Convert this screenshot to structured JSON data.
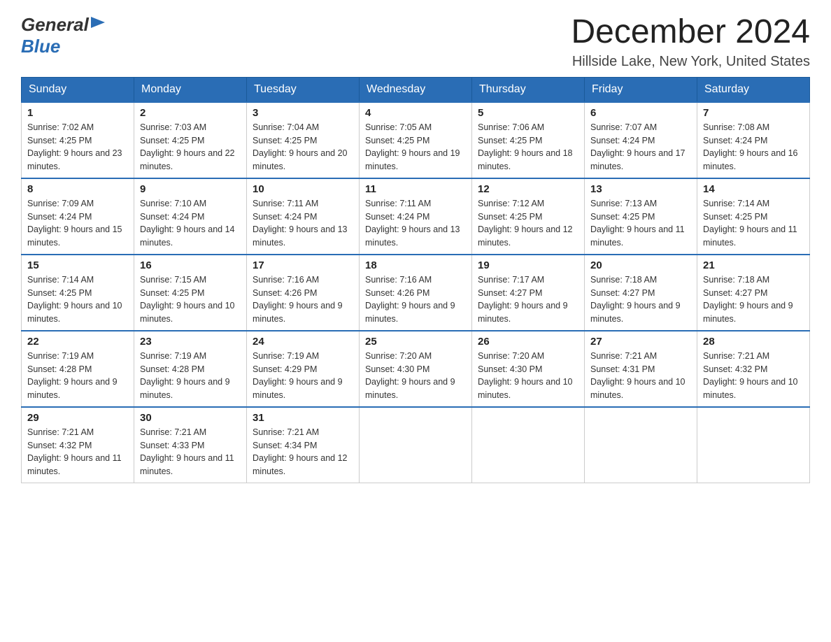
{
  "header": {
    "month_year": "December 2024",
    "location": "Hillside Lake, New York, United States"
  },
  "days_of_week": [
    "Sunday",
    "Monday",
    "Tuesday",
    "Wednesday",
    "Thursday",
    "Friday",
    "Saturday"
  ],
  "weeks": [
    [
      {
        "day": "1",
        "sunrise": "7:02 AM",
        "sunset": "4:25 PM",
        "daylight": "9 hours and 23 minutes."
      },
      {
        "day": "2",
        "sunrise": "7:03 AM",
        "sunset": "4:25 PM",
        "daylight": "9 hours and 22 minutes."
      },
      {
        "day": "3",
        "sunrise": "7:04 AM",
        "sunset": "4:25 PM",
        "daylight": "9 hours and 20 minutes."
      },
      {
        "day": "4",
        "sunrise": "7:05 AM",
        "sunset": "4:25 PM",
        "daylight": "9 hours and 19 minutes."
      },
      {
        "day": "5",
        "sunrise": "7:06 AM",
        "sunset": "4:25 PM",
        "daylight": "9 hours and 18 minutes."
      },
      {
        "day": "6",
        "sunrise": "7:07 AM",
        "sunset": "4:24 PM",
        "daylight": "9 hours and 17 minutes."
      },
      {
        "day": "7",
        "sunrise": "7:08 AM",
        "sunset": "4:24 PM",
        "daylight": "9 hours and 16 minutes."
      }
    ],
    [
      {
        "day": "8",
        "sunrise": "7:09 AM",
        "sunset": "4:24 PM",
        "daylight": "9 hours and 15 minutes."
      },
      {
        "day": "9",
        "sunrise": "7:10 AM",
        "sunset": "4:24 PM",
        "daylight": "9 hours and 14 minutes."
      },
      {
        "day": "10",
        "sunrise": "7:11 AM",
        "sunset": "4:24 PM",
        "daylight": "9 hours and 13 minutes."
      },
      {
        "day": "11",
        "sunrise": "7:11 AM",
        "sunset": "4:24 PM",
        "daylight": "9 hours and 13 minutes."
      },
      {
        "day": "12",
        "sunrise": "7:12 AM",
        "sunset": "4:25 PM",
        "daylight": "9 hours and 12 minutes."
      },
      {
        "day": "13",
        "sunrise": "7:13 AM",
        "sunset": "4:25 PM",
        "daylight": "9 hours and 11 minutes."
      },
      {
        "day": "14",
        "sunrise": "7:14 AM",
        "sunset": "4:25 PM",
        "daylight": "9 hours and 11 minutes."
      }
    ],
    [
      {
        "day": "15",
        "sunrise": "7:14 AM",
        "sunset": "4:25 PM",
        "daylight": "9 hours and 10 minutes."
      },
      {
        "day": "16",
        "sunrise": "7:15 AM",
        "sunset": "4:25 PM",
        "daylight": "9 hours and 10 minutes."
      },
      {
        "day": "17",
        "sunrise": "7:16 AM",
        "sunset": "4:26 PM",
        "daylight": "9 hours and 9 minutes."
      },
      {
        "day": "18",
        "sunrise": "7:16 AM",
        "sunset": "4:26 PM",
        "daylight": "9 hours and 9 minutes."
      },
      {
        "day": "19",
        "sunrise": "7:17 AM",
        "sunset": "4:27 PM",
        "daylight": "9 hours and 9 minutes."
      },
      {
        "day": "20",
        "sunrise": "7:18 AM",
        "sunset": "4:27 PM",
        "daylight": "9 hours and 9 minutes."
      },
      {
        "day": "21",
        "sunrise": "7:18 AM",
        "sunset": "4:27 PM",
        "daylight": "9 hours and 9 minutes."
      }
    ],
    [
      {
        "day": "22",
        "sunrise": "7:19 AM",
        "sunset": "4:28 PM",
        "daylight": "9 hours and 9 minutes."
      },
      {
        "day": "23",
        "sunrise": "7:19 AM",
        "sunset": "4:28 PM",
        "daylight": "9 hours and 9 minutes."
      },
      {
        "day": "24",
        "sunrise": "7:19 AM",
        "sunset": "4:29 PM",
        "daylight": "9 hours and 9 minutes."
      },
      {
        "day": "25",
        "sunrise": "7:20 AM",
        "sunset": "4:30 PM",
        "daylight": "9 hours and 9 minutes."
      },
      {
        "day": "26",
        "sunrise": "7:20 AM",
        "sunset": "4:30 PM",
        "daylight": "9 hours and 10 minutes."
      },
      {
        "day": "27",
        "sunrise": "7:21 AM",
        "sunset": "4:31 PM",
        "daylight": "9 hours and 10 minutes."
      },
      {
        "day": "28",
        "sunrise": "7:21 AM",
        "sunset": "4:32 PM",
        "daylight": "9 hours and 10 minutes."
      }
    ],
    [
      {
        "day": "29",
        "sunrise": "7:21 AM",
        "sunset": "4:32 PM",
        "daylight": "9 hours and 11 minutes."
      },
      {
        "day": "30",
        "sunrise": "7:21 AM",
        "sunset": "4:33 PM",
        "daylight": "9 hours and 11 minutes."
      },
      {
        "day": "31",
        "sunrise": "7:21 AM",
        "sunset": "4:34 PM",
        "daylight": "9 hours and 12 minutes."
      },
      null,
      null,
      null,
      null
    ]
  ]
}
